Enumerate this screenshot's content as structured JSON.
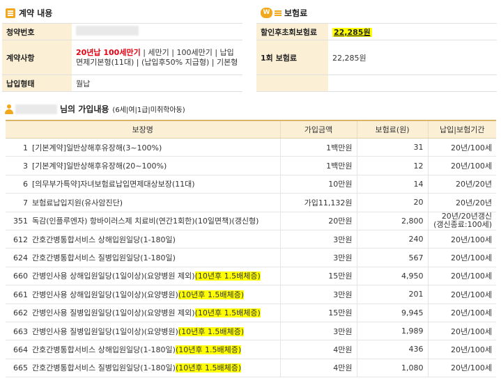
{
  "contract": {
    "title": "계약 내용",
    "rows": [
      {
        "label": "청약번호",
        "value": ""
      },
      {
        "label": "계약사항",
        "value_red": "20년납 100세만기",
        "value_rest": " | 세만기 | 100세만기 | 납입면제기본형(11대) | (납입후50% 지급형) | 기본형"
      },
      {
        "label": "납입형태",
        "value": "월납"
      }
    ]
  },
  "premium": {
    "title": "보험료",
    "icon_text": "W",
    "rows": [
      {
        "label": "할인후초회보험료",
        "value": "22,285원"
      },
      {
        "label": "1회 보험료",
        "value": "22,285원"
      },
      {
        "label": "",
        "value": ""
      }
    ]
  },
  "coverage": {
    "title_suffix": "님의 가입내용",
    "title_detail": "(6세|여|1급|미취학아동)",
    "headers": [
      "보장명",
      "가입금액",
      "보험료(원)",
      "납입|보험기간"
    ],
    "rows": [
      {
        "code": "1",
        "name": "[기본계약]일반상해후유장해(3~100%)",
        "tag": "",
        "amount": "1백만원",
        "premium": "31",
        "period": "20년/100세",
        "period2": ""
      },
      {
        "code": "3",
        "name": "[기본계약]일반상해후유장해(20~100%)",
        "tag": "",
        "amount": "1백만원",
        "premium": "12",
        "period": "20년/100세",
        "period2": ""
      },
      {
        "code": "6",
        "name": "[의무부가특약]자녀보험료납입면제대상보장(11대)",
        "tag": "",
        "amount": "10만원",
        "premium": "14",
        "period": "20년/20년",
        "period2": ""
      },
      {
        "code": "7",
        "name": "보험료납입지원(유사암진단)",
        "tag": "",
        "amount": "가입11,132원",
        "premium": "20",
        "period": "20년/20년",
        "period2": ""
      },
      {
        "code": "351",
        "name": "독감(인플루엔자) 항바이러스제 치료비(연간1회한)(10일면책)(갱신형)",
        "tag": "",
        "amount": "20만원",
        "premium": "2,800",
        "period": "20년/20년갱신",
        "period2": "(갱신종료:100세)"
      },
      {
        "code": "612",
        "name": "간호간병통합서비스 상해입원일당(1-180일)",
        "tag": "",
        "amount": "3만원",
        "premium": "240",
        "period": "20년/100세",
        "period2": ""
      },
      {
        "code": "624",
        "name": "간호간병통합서비스 질병입원일당(1-180일)",
        "tag": "",
        "amount": "3만원",
        "premium": "567",
        "period": "20년/100세",
        "period2": ""
      },
      {
        "code": "660",
        "name": "간병인사용 상해입원일당(1일이상)(요양병원 제외)",
        "tag": "(10년후 1.5배체증)",
        "amount": "15만원",
        "premium": "4,950",
        "period": "20년/100세",
        "period2": ""
      },
      {
        "code": "661",
        "name": "간병인사용 상해입원일당(1일이상)(요양병원)",
        "tag": "(10년후 1.5배체증)",
        "amount": "3만원",
        "premium": "201",
        "period": "20년/100세",
        "period2": ""
      },
      {
        "code": "662",
        "name": "간병인사용 질병입원일당(1일이상)(요양병원 제외)",
        "tag": "(10년후 1.5배체증)",
        "amount": "15만원",
        "premium": "9,945",
        "period": "20년/100세",
        "period2": ""
      },
      {
        "code": "663",
        "name": "간병인사용 질병입원일당(1일이상)(요양병원)",
        "tag": "(10년후 1.5배체증)",
        "amount": "3만원",
        "premium": "1,989",
        "period": "20년/100세",
        "period2": ""
      },
      {
        "code": "664",
        "name": "간호간병통합서비스 상해입원일당(1-180일)",
        "tag": "(10년후 1.5배체증)",
        "amount": "4만원",
        "premium": "436",
        "period": "20년/100세",
        "period2": ""
      },
      {
        "code": "665",
        "name": "간호간병통합서비스 질병입원일당(1-180일)",
        "tag": "(10년후 1.5배체증)",
        "amount": "4만원",
        "premium": "1,080",
        "period": "20년/100세",
        "period2": ""
      }
    ]
  }
}
